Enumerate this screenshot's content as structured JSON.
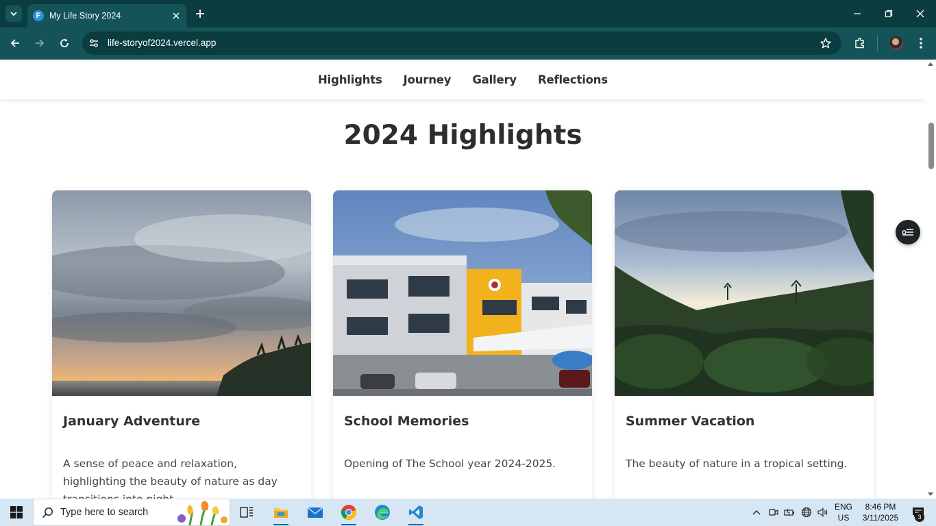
{
  "browser": {
    "tab_title": "My Life Story 2024",
    "tab_favicon_letter": "F",
    "url": "life-storyof2024.vercel.app"
  },
  "nav": {
    "items": [
      "Highlights",
      "Journey",
      "Gallery",
      "Reflections"
    ]
  },
  "section": {
    "title": "2024 Highlights"
  },
  "cards": [
    {
      "title": "January Adventure",
      "description": "A sense of peace and relaxation, highlighting the beauty of nature as day transitions into night.",
      "image": "cloudy-sunset-over-sea-photo"
    },
    {
      "title": "School Memories",
      "description": "Opening of The School year 2024-2025.",
      "image": "school-building-photo"
    },
    {
      "title": "Summer Vacation",
      "description": "The beauty of nature in a tropical setting.",
      "image": "tropical-forest-sunset-photo"
    }
  ],
  "taskbar": {
    "search_placeholder": "Type here to search",
    "lang_line1": "ENG",
    "lang_line2": "US",
    "time": "8:46 PM",
    "date": "3/11/2025",
    "notification_count": "3"
  },
  "colors": {
    "browser_frame": "#0b3d40",
    "browser_toolbar": "#145458",
    "page_text": "#333333",
    "taskbar": "#d6e6f2"
  }
}
